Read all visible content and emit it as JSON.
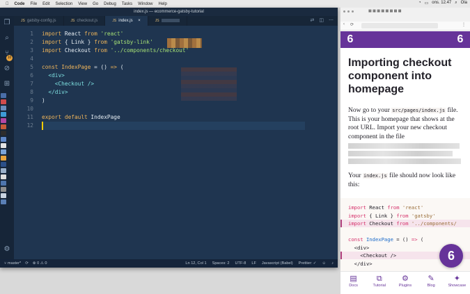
{
  "menubar": {
    "apple": "",
    "items": [
      "Code",
      "File",
      "Edit",
      "Selection",
      "View",
      "Go",
      "Debug",
      "Tasks",
      "Window",
      "Help"
    ],
    "clock": "ons. 12.47",
    "user": "Ola"
  },
  "vscode": {
    "window_title": "index.js — ecommerce-gatsby-tutorial",
    "tabs": [
      {
        "label": "gatsby-config.js",
        "active": false
      },
      {
        "label": "checkout.js",
        "active": false
      },
      {
        "label": "index.js",
        "active": true
      },
      {
        "label": "",
        "active": false
      }
    ],
    "code_lines": [
      {
        "n": "1",
        "parts": [
          [
            "kw",
            "import"
          ],
          [
            "pl",
            " React "
          ],
          [
            "kw",
            "from"
          ],
          [
            "pl",
            " "
          ],
          [
            "str",
            "'react'"
          ]
        ]
      },
      {
        "n": "2",
        "parts": [
          [
            "kw",
            "import"
          ],
          [
            "pl",
            " { Link } "
          ],
          [
            "kw",
            "from"
          ],
          [
            "pl",
            " "
          ],
          [
            "str",
            "'gatsby-link'"
          ]
        ]
      },
      {
        "n": "3",
        "parts": [
          [
            "kw",
            "import"
          ],
          [
            "pl",
            " Checkout "
          ],
          [
            "kw",
            "from"
          ],
          [
            "pl",
            " "
          ],
          [
            "str",
            "'../components/checkout'"
          ]
        ]
      },
      {
        "n": "4",
        "parts": []
      },
      {
        "n": "5",
        "parts": [
          [
            "kw",
            "const"
          ],
          [
            "pl",
            " "
          ],
          [
            "fn",
            "IndexPage"
          ],
          [
            "pl",
            " = () "
          ],
          [
            "kw",
            "=>"
          ],
          [
            "pl",
            " ("
          ]
        ]
      },
      {
        "n": "6",
        "parts": [
          [
            "pl",
            "  "
          ],
          [
            "tag",
            "<div>"
          ]
        ]
      },
      {
        "n": "7",
        "parts": [
          [
            "pl",
            "    "
          ],
          [
            "tag",
            "<Checkout />"
          ]
        ]
      },
      {
        "n": "8",
        "parts": [
          [
            "pl",
            "  "
          ],
          [
            "tag",
            "</div>"
          ]
        ]
      },
      {
        "n": "9",
        "parts": [
          [
            "pl",
            ")"
          ]
        ]
      },
      {
        "n": "10",
        "parts": []
      },
      {
        "n": "11",
        "parts": [
          [
            "kw",
            "export"
          ],
          [
            "pl",
            " "
          ],
          [
            "kw",
            "default"
          ],
          [
            "pl",
            " IndexPage"
          ]
        ]
      },
      {
        "n": "12",
        "parts": []
      }
    ],
    "status": {
      "branch": "master*",
      "sync": "",
      "problems": "0",
      "warnings": "0",
      "position": "Ln 12, Col 1",
      "spaces": "Spaces: 2",
      "encoding": "UTF-8",
      "eol": "LF",
      "language": "Javascript (Babel)",
      "prettier": "Prettier: ✓"
    },
    "badge_count": "10"
  },
  "browser": {
    "badge_number": "6",
    "title": "Importing checkout component into homepage",
    "para1_before": "Now go to your ",
    "para1_code": "src/pages/index.js",
    "para1_after": " file. This is your homepage that shows at the root URL. Import your new checkout component in the file",
    "para2_before": "Your ",
    "para2_code": "index.js",
    "para2_after": " file should now look like this:",
    "code_lines": [
      {
        "hl": false,
        "parts": [
          [
            "ckw",
            "import"
          ],
          [
            "cpl",
            " React "
          ],
          [
            "ckw",
            "from"
          ],
          [
            "cpl",
            " "
          ],
          [
            "cstr",
            "'react'"
          ]
        ]
      },
      {
        "hl": false,
        "parts": [
          [
            "ckw",
            "import"
          ],
          [
            "cpl",
            " { Link } "
          ],
          [
            "ckw",
            "from"
          ],
          [
            "cpl",
            " "
          ],
          [
            "cstr",
            "'gatsby'"
          ]
        ]
      },
      {
        "hl": true,
        "parts": [
          [
            "ckw",
            "import"
          ],
          [
            "cpl",
            " Checkout "
          ],
          [
            "ckw",
            "from"
          ],
          [
            "cpl",
            " "
          ],
          [
            "cstr",
            "'../components/"
          ]
        ]
      },
      {
        "hl": false,
        "parts": []
      },
      {
        "hl": false,
        "parts": [
          [
            "ckw",
            "const"
          ],
          [
            "cpl",
            " "
          ],
          [
            "cbl",
            "IndexPage"
          ],
          [
            "cpl",
            " = () "
          ],
          [
            "ckw",
            "=>"
          ],
          [
            "cpl",
            " ("
          ]
        ]
      },
      {
        "hl": false,
        "parts": [
          [
            "cpl",
            "  <div>"
          ]
        ]
      },
      {
        "hl": true,
        "parts": [
          [
            "cpl",
            "    <Checkout />"
          ]
        ]
      },
      {
        "hl": false,
        "parts": [
          [
            "cpl",
            "  </div>"
          ]
        ]
      }
    ],
    "fab_number": "6",
    "nav": [
      {
        "label": "Docs",
        "icon": "docs-icon",
        "glyph": "▤"
      },
      {
        "label": "Tutorial",
        "icon": "tutorial-icon",
        "glyph": "⧉"
      },
      {
        "label": "Plugins",
        "icon": "plugins-icon",
        "glyph": "⚙"
      },
      {
        "label": "Blog",
        "icon": "blog-icon",
        "glyph": "✎"
      },
      {
        "label": "Showcase",
        "icon": "showcase-icon",
        "glyph": "✦"
      }
    ]
  }
}
